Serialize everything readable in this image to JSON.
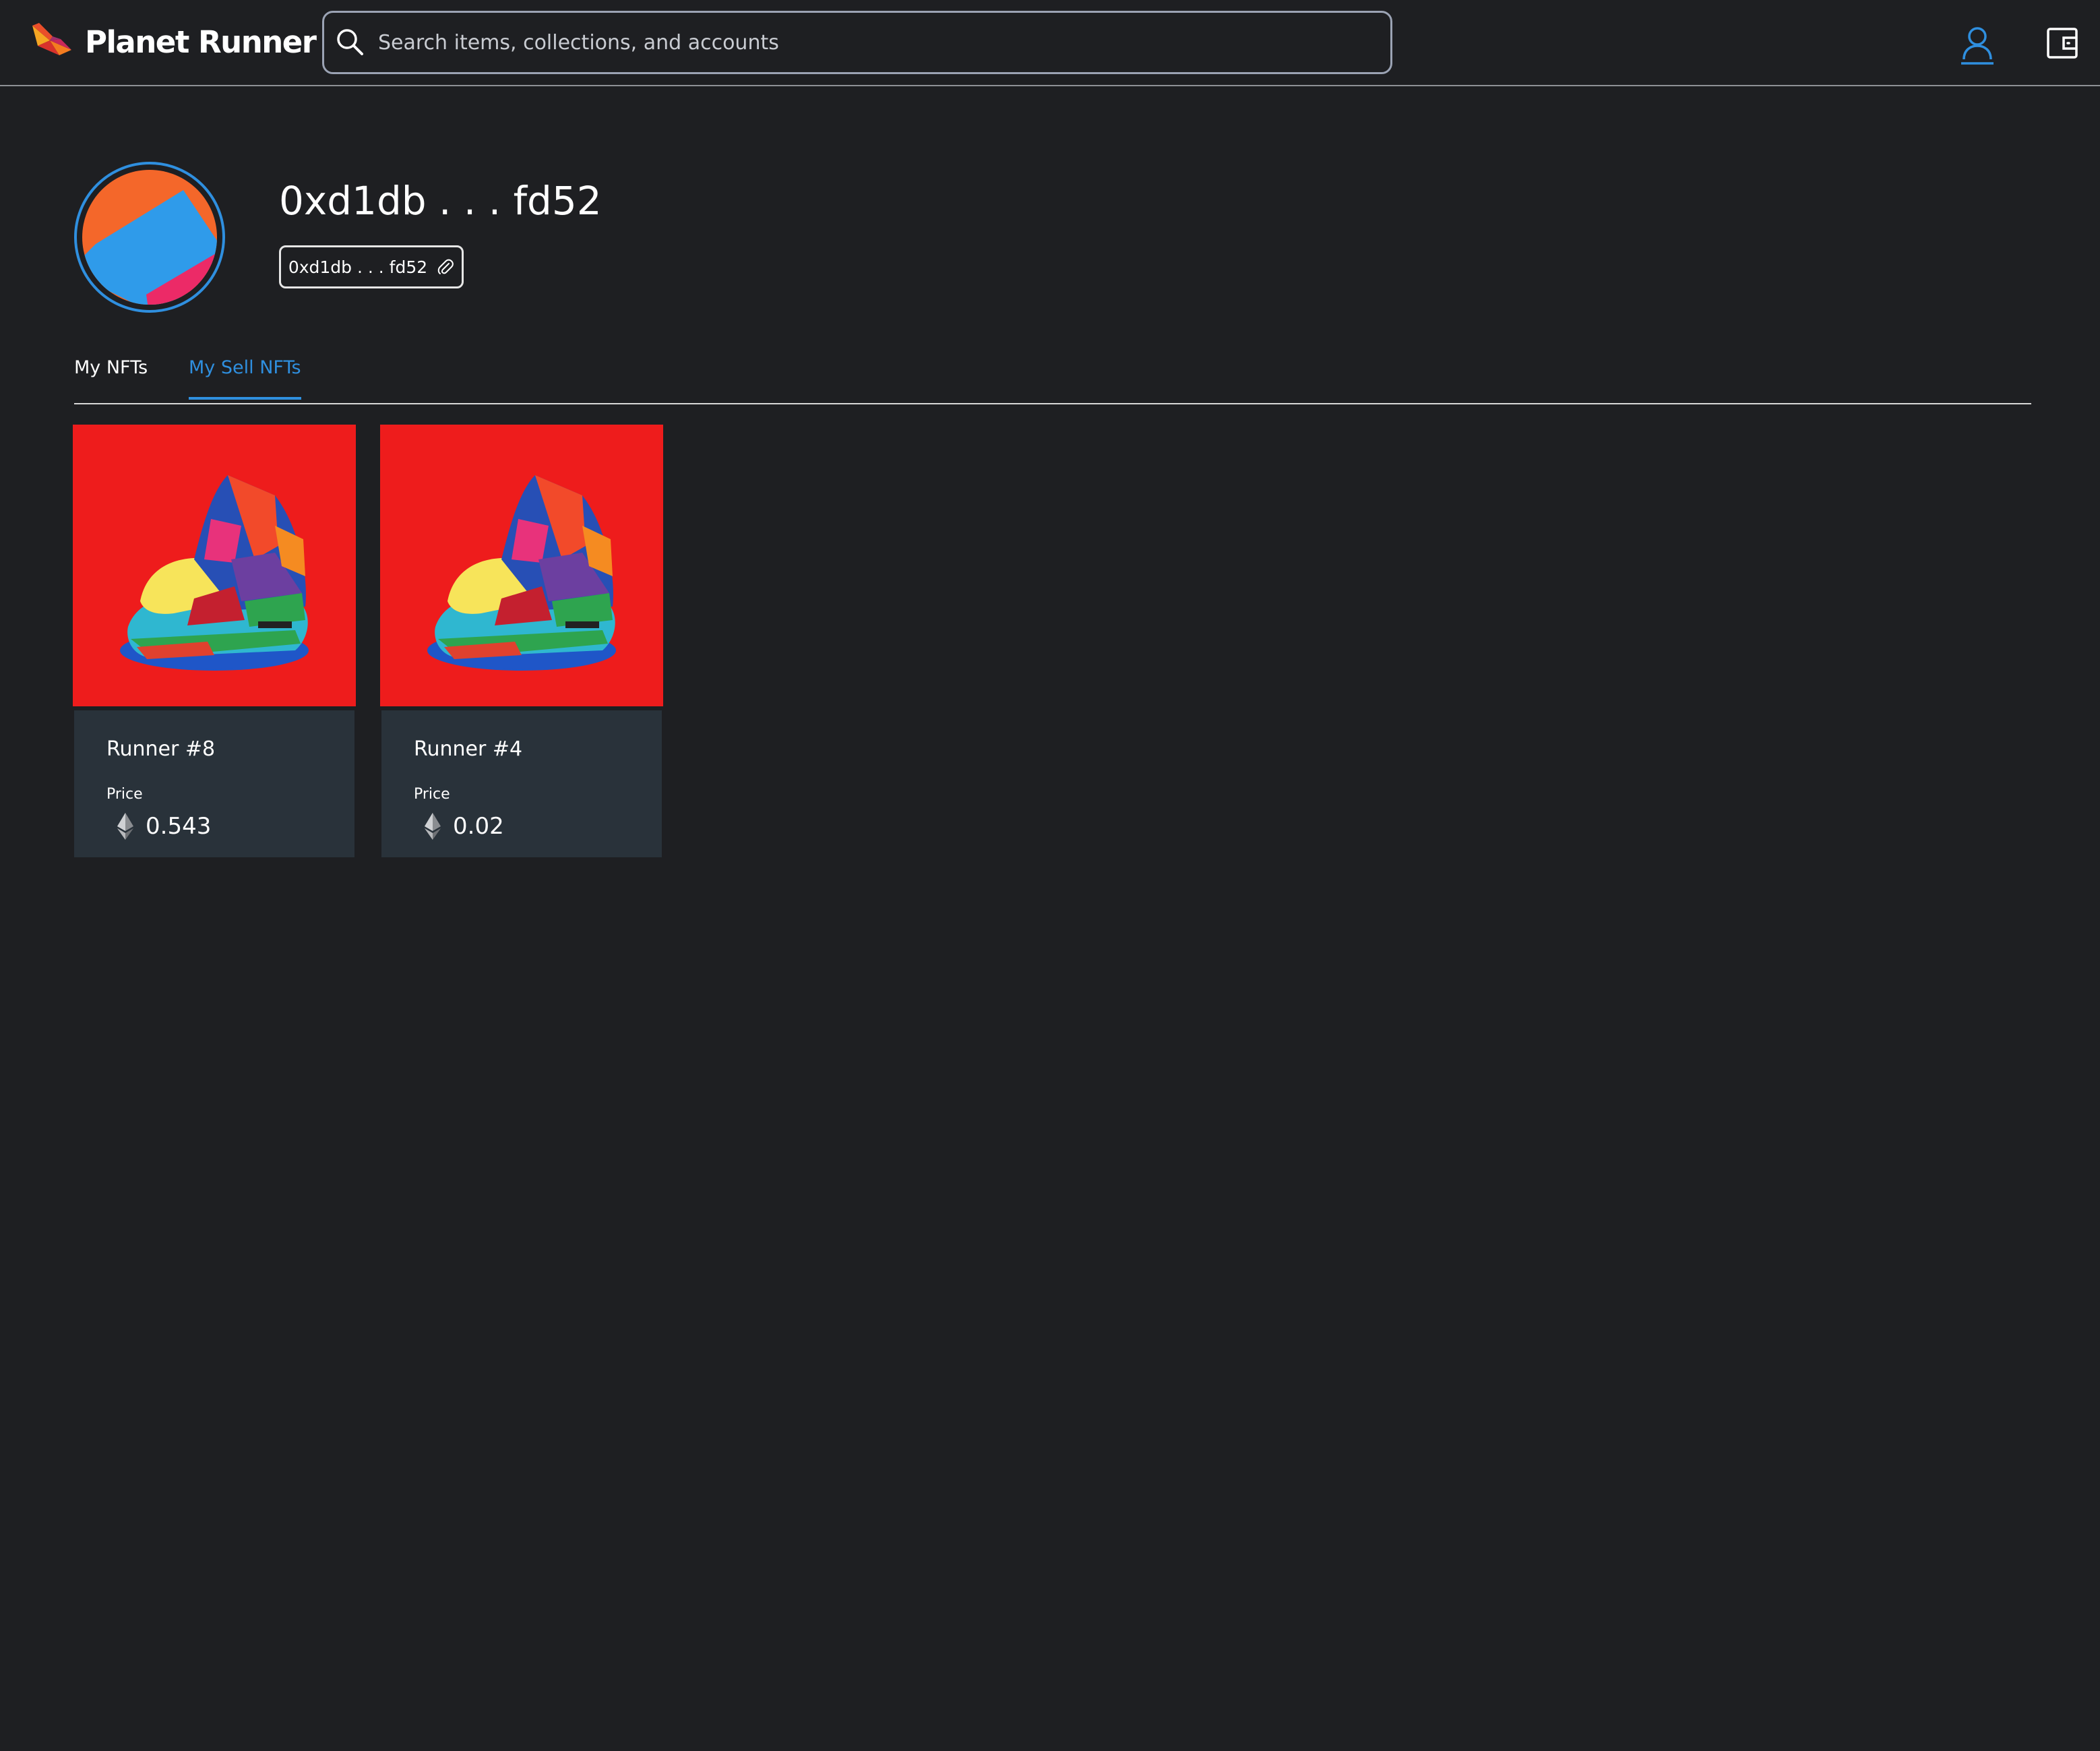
{
  "header": {
    "brand": "Planet Runner",
    "search": {
      "placeholder": "Search items, collections, and accounts",
      "value": ""
    },
    "icons": [
      "search-icon",
      "account-icon",
      "wallet-icon"
    ]
  },
  "profile": {
    "display_name": "0xd1db . . . fd52",
    "address_short": "0xd1db . . . fd52",
    "copy_icon": "paperclip-icon"
  },
  "tabs": [
    {
      "label": "My NFTs",
      "active": false
    },
    {
      "label": "My Sell NFTs",
      "active": true
    }
  ],
  "nfts": [
    {
      "title": "Runner #8",
      "price_label": "Price",
      "price": "0.543",
      "currency_icon": "ethereum-icon"
    },
    {
      "title": "Runner #4",
      "price_label": "Price",
      "price": "0.02",
      "currency_icon": "ethereum-icon"
    }
  ],
  "colors": {
    "background": "#1e1f22",
    "accent": "#2f8fdf",
    "card_body": "#29323a",
    "card_image_bg": "#ee1c1c"
  }
}
